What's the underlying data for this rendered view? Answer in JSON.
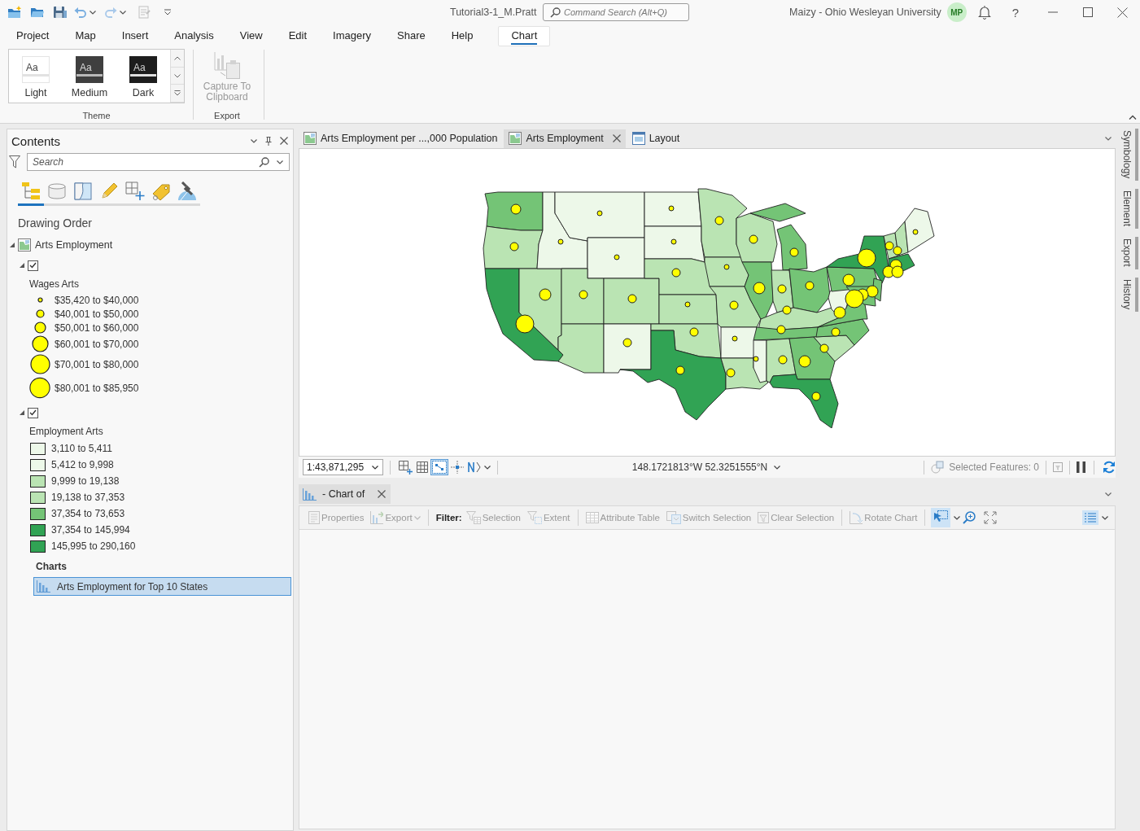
{
  "title_bar": {
    "document_title": "Tutorial3-1_M.Pratt",
    "command_search": {
      "placeholder": "Command Search (Alt+Q)"
    },
    "user": "Maizy - Ohio Wesleyan University",
    "avatar": "MP",
    "help": "?"
  },
  "ribbon": {
    "tabs": [
      {
        "label": "Project",
        "selected": false
      },
      {
        "label": "Map",
        "selected": false
      },
      {
        "label": "Insert",
        "selected": false
      },
      {
        "label": "Analysis",
        "selected": false
      },
      {
        "label": "View",
        "selected": false
      },
      {
        "label": "Edit",
        "selected": false
      },
      {
        "label": "Imagery",
        "selected": false
      },
      {
        "label": "Share",
        "selected": false
      },
      {
        "label": "Help",
        "selected": false
      },
      {
        "label": "Chart",
        "selected": true
      }
    ],
    "groups": [
      {
        "kind": "gallery",
        "label": "Theme",
        "items": [
          {
            "kind": "light",
            "preview": "Aa",
            "label": "Light"
          },
          {
            "kind": "medium",
            "preview": "Aa",
            "label": "Medium"
          },
          {
            "kind": "dark",
            "preview": "Aa",
            "label": "Dark"
          }
        ]
      },
      {
        "kind": "buttons",
        "label": "Export",
        "items": [
          {
            "label": "Capture To Clipboard",
            "disabled": true
          }
        ]
      }
    ]
  },
  "contents": {
    "title": "Contents",
    "search": {
      "placeholder": "Search"
    },
    "views": [
      {
        "kind": "tree",
        "selected": true
      },
      {
        "kind": "cylinder",
        "selected": false
      },
      {
        "kind": "map-sheet",
        "selected": false
      },
      {
        "kind": "pencil",
        "selected": false
      },
      {
        "kind": "grid-plus",
        "selected": false
      },
      {
        "kind": "tag",
        "selected": false
      },
      {
        "kind": "satellite",
        "selected": false
      }
    ],
    "heading": "Drawing Order",
    "tree": [
      {
        "label": "Arts Employment",
        "expanded": true,
        "layers": [
          {
            "checked": true,
            "expanded": true,
            "legend": {
              "title": "Wages Arts",
              "kind": "symbols",
              "items": [
                {
                  "label": "$35,420 to $40,000"
                },
                {
                  "label": "$40,001 to $50,000"
                },
                {
                  "label": "$50,001 to $60,000"
                },
                {
                  "label": "$60,001 to $70,000"
                },
                {
                  "label": "$70,001 to $80,000"
                },
                {
                  "label": "$80,001 to $85,950"
                }
              ]
            }
          },
          {
            "checked": true,
            "expanded": true,
            "legend": {
              "title": "Employment Arts",
              "kind": "swatches",
              "items": [
                {
                  "label": "3,110 to 5,411",
                  "color": "#edf8e9"
                },
                {
                  "label": "5,412 to 9,998",
                  "color": "#edf8e9"
                },
                {
                  "label": "9,999 to 19,138",
                  "color": "#bae4b3"
                },
                {
                  "label": "19,138 to 37,353",
                  "color": "#bae4b3"
                },
                {
                  "label": "37,354 to 73,653",
                  "color": "#74c476"
                },
                {
                  "label": "37,354 to 145,994",
                  "color": "#31a354"
                },
                {
                  "label": "145,995 to 290,160",
                  "color": "#31a354"
                }
              ]
            }
          }
        ],
        "charts": {
          "title": "Charts",
          "items": [
            {
              "label": "Arts Employment for Top 10 States",
              "selected": true
            }
          ]
        }
      }
    ]
  },
  "map_view": {
    "tabs": [
      {
        "kind": "map",
        "label": "Arts Employment per ...,000 Population",
        "selected": false
      },
      {
        "kind": "map",
        "label": "Arts Employment",
        "selected": true
      },
      {
        "kind": "layout",
        "label": "Layout",
        "selected": false
      }
    ],
    "scale": "1:43,871,295",
    "tools": [
      {
        "kind": "grid-plus",
        "selected": false
      },
      {
        "kind": "grid",
        "selected": false
      },
      {
        "kind": "snap-grid",
        "selected": true
      },
      {
        "kind": "crosshair",
        "selected": false
      },
      {
        "kind": "north-arrow",
        "selected": false,
        "dropdown": true
      }
    ],
    "coordinates": "148.1721813°W 52.3251555°N",
    "selected_features": "Selected Features: 0"
  },
  "chart_view": {
    "tabs": [
      {
        "label": "- Chart of",
        "selected": true
      }
    ],
    "toolbar": [
      {
        "items": [
          {
            "kind": "properties",
            "label": "Properties",
            "disabled": true
          },
          {
            "kind": "export",
            "label": "Export",
            "disabled": true,
            "dropdown": true
          }
        ]
      },
      {
        "items": [
          {
            "kind": "label",
            "label": "Filter:"
          },
          {
            "kind": "selection",
            "label": "Selection",
            "disabled": true
          },
          {
            "kind": "extent",
            "label": "Extent",
            "disabled": true
          }
        ]
      },
      {
        "items": [
          {
            "kind": "table",
            "label": "Attribute Table",
            "disabled": true
          },
          {
            "kind": "switch",
            "label": "Switch Selection",
            "disabled": true
          },
          {
            "kind": "clear",
            "label": "Clear Selection",
            "disabled": true
          }
        ]
      },
      {
        "items": [
          {
            "kind": "rotate",
            "label": "Rotate Chart",
            "disabled": true
          }
        ]
      },
      {
        "items": [
          {
            "kind": "select-tool",
            "selected": true,
            "dropdown": true
          },
          {
            "kind": "zoom-in",
            "selected": false
          },
          {
            "kind": "full-extent",
            "selected": false
          }
        ]
      }
    ],
    "legend_toggle": {
      "selected": true,
      "dropdown": true
    }
  },
  "side_tabs": [
    "Symbology",
    "Element",
    "Export",
    "History"
  ]
}
